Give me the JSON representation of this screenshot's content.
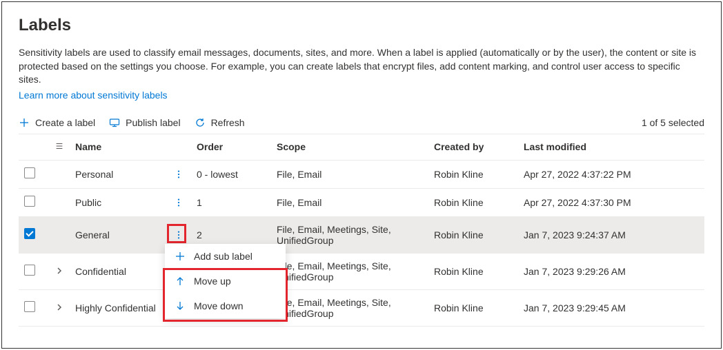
{
  "title": "Labels",
  "description": "Sensitivity labels are used to classify email messages, documents, sites, and more. When a label is applied (automatically or by the user), the content or site is protected based on the settings you choose. For example, you can create labels that encrypt files, add content marking, and control user access to specific sites.",
  "learn_more": "Learn more about sensitivity labels",
  "toolbar": {
    "create": "Create a label",
    "publish": "Publish label",
    "refresh": "Refresh"
  },
  "selection_status": "1 of 5 selected",
  "columns": {
    "name": "Name",
    "order": "Order",
    "scope": "Scope",
    "created_by": "Created by",
    "last_modified": "Last modified"
  },
  "rows": [
    {
      "name": "Personal",
      "order": "0 - lowest",
      "scope": "File, Email",
      "created_by": "Robin Kline",
      "last_modified": "Apr 27, 2022 4:37:22 PM",
      "selected": false,
      "expandable": false
    },
    {
      "name": "Public",
      "order": "1",
      "scope": "File, Email",
      "created_by": "Robin Kline",
      "last_modified": "Apr 27, 2022 4:37:30 PM",
      "selected": false,
      "expandable": false
    },
    {
      "name": "General",
      "order": "2",
      "scope": "File, Email, Meetings, Site, UnifiedGroup",
      "created_by": "Robin Kline",
      "last_modified": "Jan 7, 2023 9:24:37 AM",
      "selected": true,
      "expandable": false
    },
    {
      "name": "Confidential",
      "order": "",
      "scope": "File, Email, Meetings, Site, UnifiedGroup",
      "created_by": "Robin Kline",
      "last_modified": "Jan 7, 2023 9:29:26 AM",
      "selected": false,
      "expandable": true
    },
    {
      "name": "Highly Confidential",
      "order": "",
      "scope": "File, Email, Meetings, Site, UnifiedGroup",
      "created_by": "Robin Kline",
      "last_modified": "Jan 7, 2023 9:29:45 AM",
      "selected": false,
      "expandable": true
    }
  ],
  "context_menu": {
    "add_sub": "Add sub label",
    "move_up": "Move up",
    "move_down": "Move down"
  }
}
